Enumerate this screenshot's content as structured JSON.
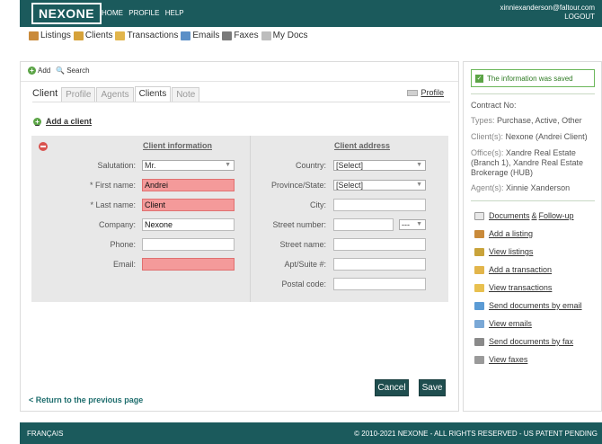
{
  "header": {
    "logo": "NEXONE",
    "nav": [
      "HOME",
      "PROFILE",
      "HELP"
    ],
    "account_email": "xinniexanderson@faltour.com",
    "logout": "LOGOUT"
  },
  "iconnav": [
    {
      "label": "Listings",
      "icon": "house-icon",
      "color": "#c98a3a"
    },
    {
      "label": "Clients",
      "icon": "clients-icon",
      "color": "#d6a23a"
    },
    {
      "label": "Transactions",
      "icon": "folder-icon",
      "color": "#e2b54b"
    },
    {
      "label": "Emails",
      "icon": "email-icon",
      "color": "#5b8fc7"
    },
    {
      "label": "Faxes",
      "icon": "fax-icon",
      "color": "#7a7a7a"
    },
    {
      "label": "My Docs",
      "icon": "docs-icon",
      "color": "#bdbdbd"
    }
  ],
  "toolbar": {
    "add": "Add",
    "search": "Search"
  },
  "tabs": {
    "title": "Client",
    "items": [
      "Profile",
      "Agents",
      "Clients",
      "Note"
    ],
    "active": "Clients",
    "profile_link": "Profile"
  },
  "add_client": "Add a client",
  "form": {
    "left_title": "Client information",
    "right_title": "Client address",
    "salutation": {
      "label": "Salutation:",
      "value": "Mr."
    },
    "first_name": {
      "label": "* First name:",
      "value": "Andrei"
    },
    "last_name": {
      "label": "* Last name:",
      "value": "Client"
    },
    "company": {
      "label": "Company:",
      "value": "Nexone"
    },
    "phone": {
      "label": "Phone:",
      "value": ""
    },
    "email": {
      "label": "Email:",
      "value": ""
    },
    "country": {
      "label": "Country:",
      "value": "[Select]"
    },
    "province": {
      "label": "Province/State:",
      "value": "[Select]"
    },
    "city": {
      "label": "City:",
      "value": ""
    },
    "street_number": {
      "label": "Street number:",
      "value": "",
      "suffix": "---"
    },
    "street_name": {
      "label": "Street name:",
      "value": ""
    },
    "apt": {
      "label": "Apt/Suite #:",
      "value": ""
    },
    "postal": {
      "label": "Postal code:",
      "value": ""
    }
  },
  "buttons": {
    "cancel": "Cancel",
    "save": "Save"
  },
  "back_link": "< Return to the previous page",
  "sidebar": {
    "saved_message": "The information was saved",
    "contract_label": "Contract No:",
    "types_label": "Types:",
    "types_value": "Purchase, Active, Other",
    "clients_label": "Client(s):",
    "clients_value": "Nexone (Andrei Client)",
    "offices_label": "Office(s):",
    "offices_value": "Xandre Real Estate (Branch 1), Xandre Real Estate Brokerage (HUB)",
    "agents_label": "Agent(s):",
    "agents_value": "Xinnie Xanderson",
    "docs_label": "Documents",
    "docs_amp": "&",
    "followup_label": "Follow-up",
    "actions": [
      {
        "label": "Add a listing",
        "icon": "house-add-icon",
        "color": "#c98a3a"
      },
      {
        "label": "View listings",
        "icon": "listings-icon",
        "color": "#c9a33a"
      },
      {
        "label": "Add a transaction",
        "icon": "folder-add-icon",
        "color": "#e2b54b"
      },
      {
        "label": "View transactions",
        "icon": "folder-view-icon",
        "color": "#e8c04f"
      },
      {
        "label": "Send documents by email",
        "icon": "email-doc-icon",
        "color": "#5b9bd5"
      },
      {
        "label": "View emails",
        "icon": "emails-icon",
        "color": "#7aa8d6"
      },
      {
        "label": "Send documents by fax",
        "icon": "fax-send-icon",
        "color": "#8a8a8a"
      },
      {
        "label": "View faxes",
        "icon": "faxes-icon",
        "color": "#9a9a9a"
      }
    ]
  },
  "footer": {
    "language": "FRANÇAIS",
    "copyright": "© 2010-2021 NEXONE - ALL RIGHTS RESERVED - US PATENT PENDING"
  }
}
